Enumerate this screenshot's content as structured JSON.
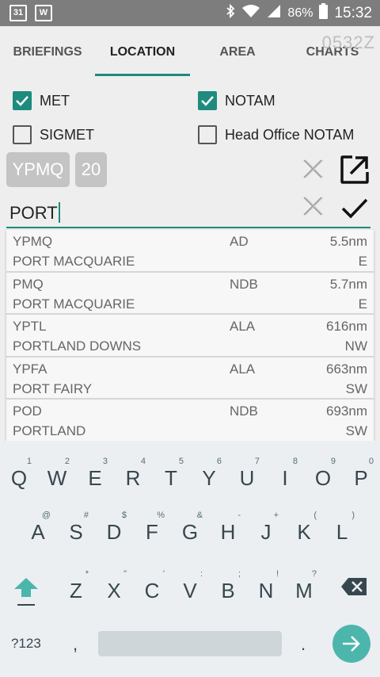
{
  "status_bar": {
    "calendar_day": "31",
    "word_icon_letter": "W",
    "battery": "86%",
    "time": "15:32"
  },
  "tabs": {
    "items": [
      "BRIEFINGS",
      "LOCATION",
      "AREA",
      "CHARTS"
    ],
    "active": "LOCATION",
    "stamp": "0532Z"
  },
  "filters": {
    "met": {
      "label": "MET",
      "checked": true
    },
    "notam": {
      "label": "NOTAM",
      "checked": true
    },
    "sigmet": {
      "label": "SIGMET",
      "checked": false
    },
    "head_office_notam": {
      "label": "Head Office NOTAM",
      "checked": false
    }
  },
  "location": {
    "code": "YPMQ",
    "radius": "20"
  },
  "search": {
    "value": "PORT"
  },
  "results": [
    {
      "code": "YPMQ",
      "type": "AD",
      "distance": "5.5nm",
      "name": "PORT MACQUARIE",
      "direction": "E"
    },
    {
      "code": "PMQ",
      "type": "NDB",
      "distance": "5.7nm",
      "name": "PORT MACQUARIE",
      "direction": "E"
    },
    {
      "code": "YPTL",
      "type": "ALA",
      "distance": "616nm",
      "name": "PORTLAND DOWNS",
      "direction": "NW"
    },
    {
      "code": "YPFA",
      "type": "ALA",
      "distance": "663nm",
      "name": "PORT FAIRY",
      "direction": "SW"
    },
    {
      "code": "POD",
      "type": "NDB",
      "distance": "693nm",
      "name": "PORTLAND",
      "direction": "SW"
    }
  ],
  "keyboard": {
    "row1": [
      {
        "k": "Q",
        "h": "1"
      },
      {
        "k": "W",
        "h": "2"
      },
      {
        "k": "E",
        "h": "3"
      },
      {
        "k": "R",
        "h": "4"
      },
      {
        "k": "T",
        "h": "5"
      },
      {
        "k": "Y",
        "h": "6"
      },
      {
        "k": "U",
        "h": "7"
      },
      {
        "k": "I",
        "h": "8"
      },
      {
        "k": "O",
        "h": "9"
      },
      {
        "k": "P",
        "h": "0"
      }
    ],
    "row2": [
      {
        "k": "A",
        "h": "@"
      },
      {
        "k": "S",
        "h": "#"
      },
      {
        "k": "D",
        "h": "$"
      },
      {
        "k": "F",
        "h": "%"
      },
      {
        "k": "G",
        "h": "&"
      },
      {
        "k": "H",
        "h": "-"
      },
      {
        "k": "J",
        "h": "+"
      },
      {
        "k": "K",
        "h": "("
      },
      {
        "k": "L",
        "h": ")"
      }
    ],
    "row3": [
      {
        "k": "Z",
        "h": "*"
      },
      {
        "k": "X",
        "h": "\""
      },
      {
        "k": "C",
        "h": "'"
      },
      {
        "k": "V",
        "h": ":"
      },
      {
        "k": "B",
        "h": ";"
      },
      {
        "k": "N",
        "h": "!"
      },
      {
        "k": "M",
        "h": "?"
      }
    ],
    "symbols_label": "?123",
    "comma": ",",
    "period": "."
  },
  "colors": {
    "accent": "#1e8b7e",
    "enter_key": "#4db6ac",
    "chip": "#c4c4c4"
  }
}
